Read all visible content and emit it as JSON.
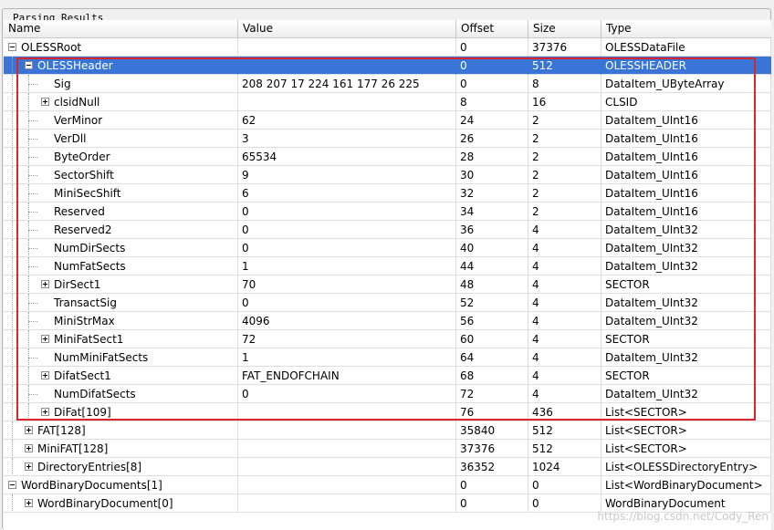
{
  "panel": {
    "title": "Parsing Results"
  },
  "columns": [
    "Name",
    "Value",
    "Offset",
    "Size",
    "Type"
  ],
  "rows": [
    {
      "name": "OLESSRoot",
      "value": "",
      "offset": "0",
      "size": "37376",
      "type": "OLESSDataFile",
      "level": 0,
      "expander": "minus"
    },
    {
      "name": "OLESSHeader",
      "value": "",
      "offset": "0",
      "size": "512",
      "type": "OLESSHEADER",
      "level": 1,
      "expander": "minus",
      "selected": true
    },
    {
      "name": "Sig",
      "value": "208 207 17 224 161 177 26 225",
      "offset": "0",
      "size": "8",
      "type": "DataItem_UByteArray",
      "level": 2,
      "expander": "none"
    },
    {
      "name": "clsidNull",
      "value": "",
      "offset": "8",
      "size": "16",
      "type": "CLSID",
      "level": 2,
      "expander": "plus"
    },
    {
      "name": "VerMinor",
      "value": "62",
      "offset": "24",
      "size": "2",
      "type": "DataItem_UInt16",
      "level": 2,
      "expander": "none"
    },
    {
      "name": "VerDll",
      "value": "3",
      "offset": "26",
      "size": "2",
      "type": "DataItem_UInt16",
      "level": 2,
      "expander": "none"
    },
    {
      "name": "ByteOrder",
      "value": "65534",
      "offset": "28",
      "size": "2",
      "type": "DataItem_UInt16",
      "level": 2,
      "expander": "none"
    },
    {
      "name": "SectorShift",
      "value": "9",
      "offset": "30",
      "size": "2",
      "type": "DataItem_UInt16",
      "level": 2,
      "expander": "none"
    },
    {
      "name": "MiniSecShift",
      "value": "6",
      "offset": "32",
      "size": "2",
      "type": "DataItem_UInt16",
      "level": 2,
      "expander": "none"
    },
    {
      "name": "Reserved",
      "value": "0",
      "offset": "34",
      "size": "2",
      "type": "DataItem_UInt16",
      "level": 2,
      "expander": "none"
    },
    {
      "name": "Reserved2",
      "value": "0",
      "offset": "36",
      "size": "4",
      "type": "DataItem_UInt32",
      "level": 2,
      "expander": "none"
    },
    {
      "name": "NumDirSects",
      "value": "0",
      "offset": "40",
      "size": "4",
      "type": "DataItem_UInt32",
      "level": 2,
      "expander": "none"
    },
    {
      "name": "NumFatSects",
      "value": "1",
      "offset": "44",
      "size": "4",
      "type": "DataItem_UInt32",
      "level": 2,
      "expander": "none"
    },
    {
      "name": "DirSect1",
      "value": "70",
      "offset": "48",
      "size": "4",
      "type": "SECTOR",
      "level": 2,
      "expander": "plus"
    },
    {
      "name": "TransactSig",
      "value": "0",
      "offset": "52",
      "size": "4",
      "type": "DataItem_UInt32",
      "level": 2,
      "expander": "none"
    },
    {
      "name": "MiniStrMax",
      "value": "4096",
      "offset": "56",
      "size": "4",
      "type": "DataItem_UInt32",
      "level": 2,
      "expander": "none"
    },
    {
      "name": "MiniFatSect1",
      "value": "72",
      "offset": "60",
      "size": "4",
      "type": "SECTOR",
      "level": 2,
      "expander": "plus"
    },
    {
      "name": "NumMiniFatSects",
      "value": "1",
      "offset": "64",
      "size": "4",
      "type": "DataItem_UInt32",
      "level": 2,
      "expander": "none"
    },
    {
      "name": "DifatSect1",
      "value": "FAT_ENDOFCHAIN",
      "offset": "68",
      "size": "4",
      "type": "SECTOR",
      "level": 2,
      "expander": "plus"
    },
    {
      "name": "NumDifatSects",
      "value": "0",
      "offset": "72",
      "size": "4",
      "type": "DataItem_UInt32",
      "level": 2,
      "expander": "none"
    },
    {
      "name": "DiFat[109]",
      "value": "",
      "offset": "76",
      "size": "436",
      "type": "List<SECTOR>",
      "level": 2,
      "expander": "plus"
    },
    {
      "name": "FAT[128]",
      "value": "",
      "offset": "35840",
      "size": "512",
      "type": "List<SECTOR>",
      "level": 1,
      "expander": "plus"
    },
    {
      "name": "MiniFAT[128]",
      "value": "",
      "offset": "37376",
      "size": "512",
      "type": "List<SECTOR>",
      "level": 1,
      "expander": "plus"
    },
    {
      "name": "DirectoryEntries[8]",
      "value": "",
      "offset": "36352",
      "size": "1024",
      "type": "List<OLESSDirectoryEntry>",
      "level": 1,
      "expander": "plus"
    },
    {
      "name": "WordBinaryDocuments[1]",
      "value": "",
      "offset": "0",
      "size": "0",
      "type": "List<WordBinaryDocument>",
      "level": 0,
      "expander": "minus"
    },
    {
      "name": "WordBinaryDocument[0]",
      "value": "",
      "offset": "0",
      "size": "0",
      "type": "WordBinaryDocument",
      "level": 1,
      "expander": "plus"
    }
  ],
  "watermark": "https://blog.csdn.net/Cody_Ren",
  "colors": {
    "selection": "#3875d7",
    "highlight_box": "#d9252b"
  }
}
